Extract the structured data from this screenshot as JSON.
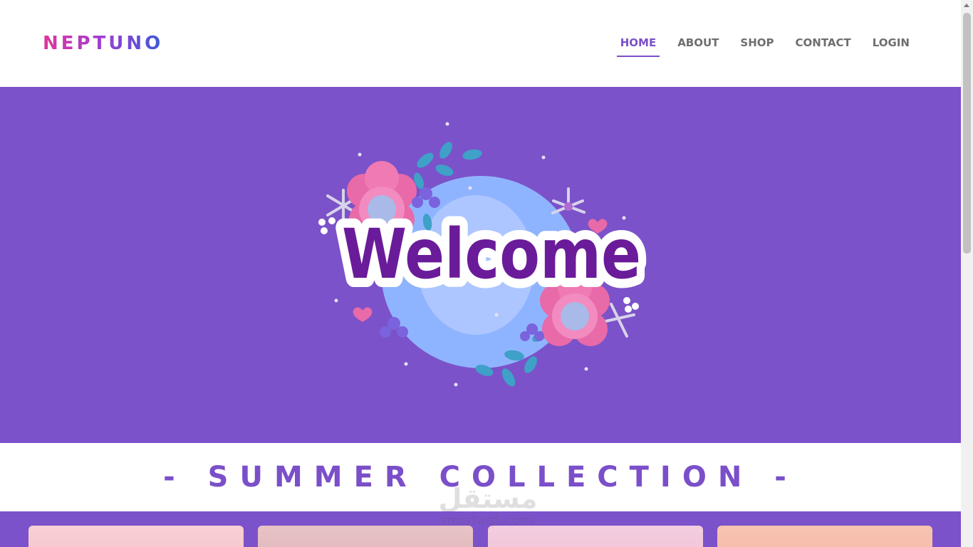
{
  "header": {
    "logo": "NEPTUNO",
    "nav": [
      {
        "label": "HOME",
        "active": true
      },
      {
        "label": "ABOUT",
        "active": false
      },
      {
        "label": "SHOP",
        "active": false
      },
      {
        "label": "CONTACT",
        "active": false
      },
      {
        "label": "LOGIN",
        "active": false
      }
    ]
  },
  "hero": {
    "banner_text": "Welcome",
    "background_color": "#7b52c9"
  },
  "section": {
    "title": "- SUMMER COLLECTION -"
  },
  "watermark": {
    "arabic": "مستقل",
    "latin": "mostaql.com"
  },
  "colors": {
    "accent": "#7b4fc9",
    "nav_text": "#6e6e6e"
  }
}
